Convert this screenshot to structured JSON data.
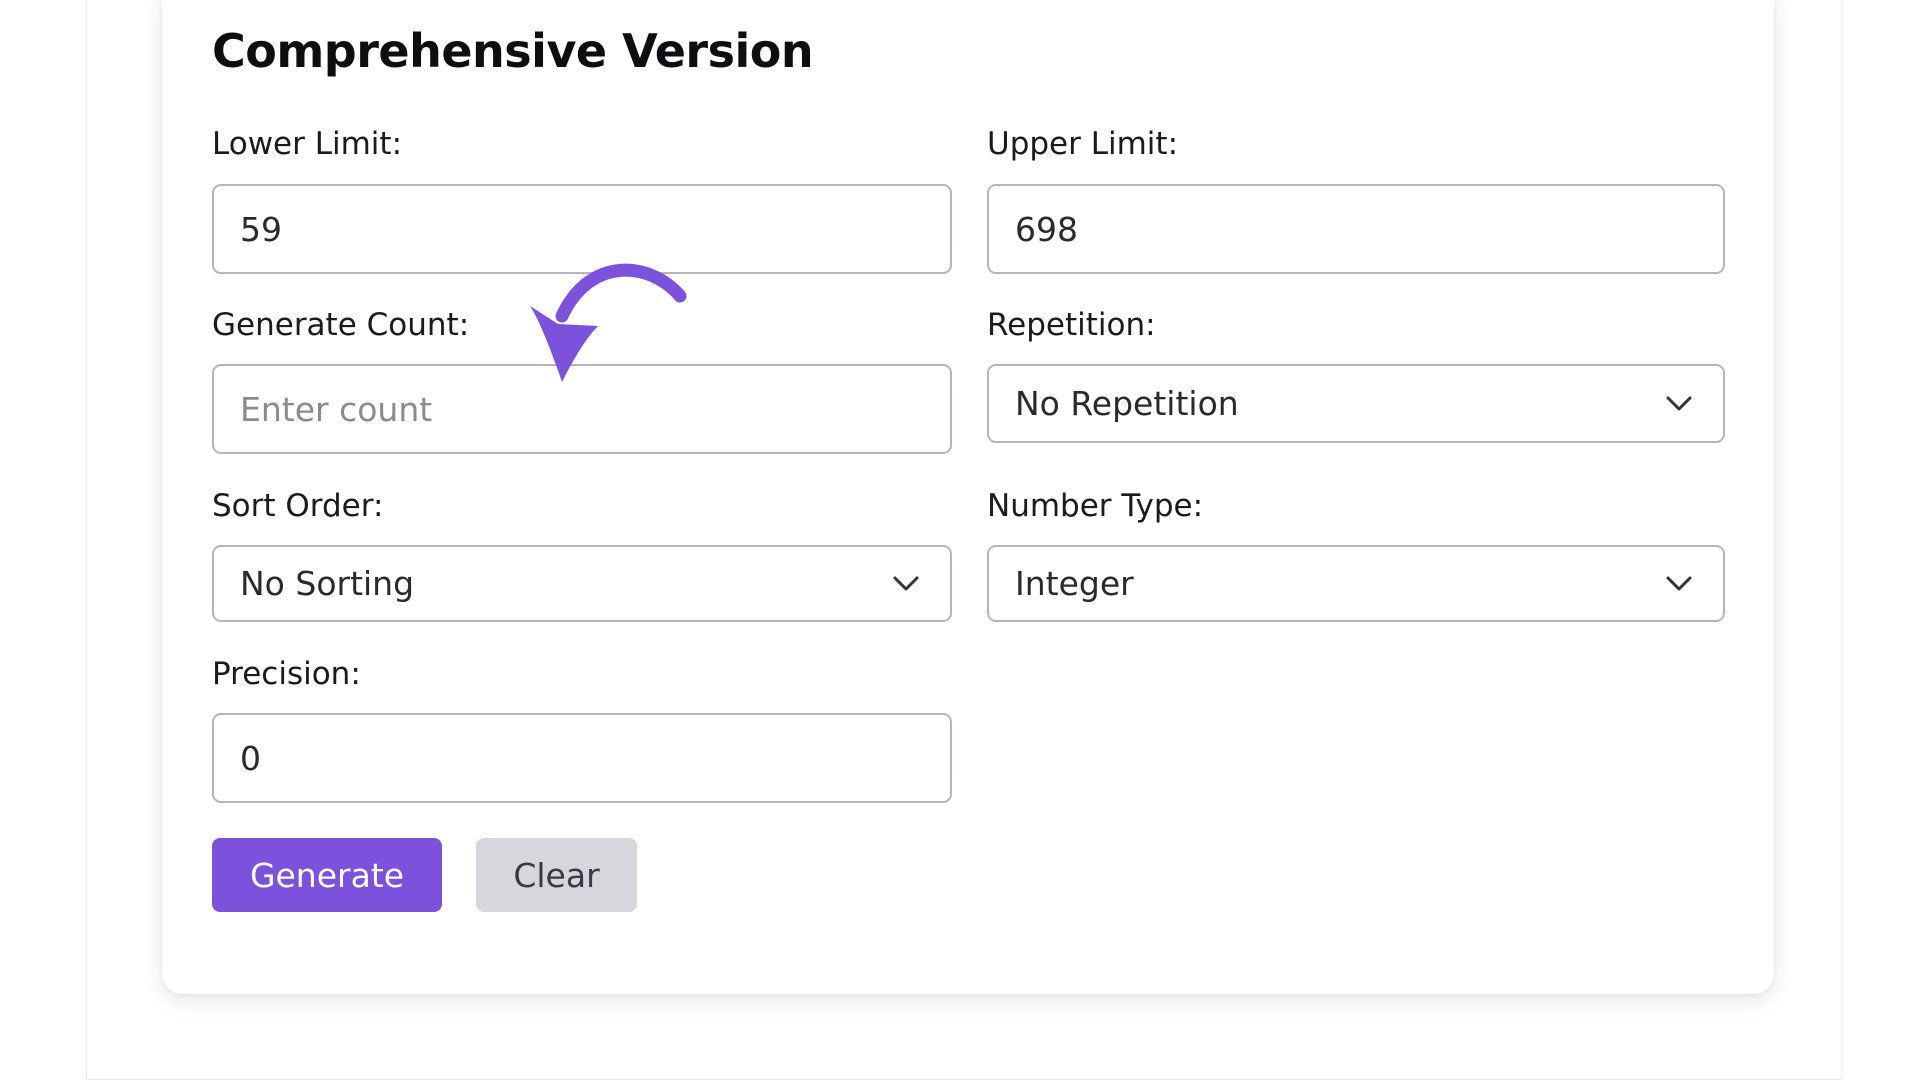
{
  "form": {
    "title": "Comprehensive Version",
    "lower_limit": {
      "label": "Lower Limit:",
      "value": "59"
    },
    "upper_limit": {
      "label": "Upper Limit:",
      "value": "698"
    },
    "generate_count": {
      "label": "Generate Count:",
      "value": "",
      "placeholder": "Enter count"
    },
    "repetition": {
      "label": "Repetition:",
      "selected": "No Repetition"
    },
    "sort_order": {
      "label": "Sort Order:",
      "selected": "No Sorting"
    },
    "number_type": {
      "label": "Number Type:",
      "selected": "Integer"
    },
    "precision": {
      "label": "Precision:",
      "value": "0"
    },
    "generate_button": "Generate",
    "clear_button": "Clear"
  },
  "annotation": {
    "icon": "curved-arrow-icon",
    "color": "#7c52dc"
  },
  "colors": {
    "accent": "#7c52dc",
    "secondary_button": "#d6d7dc",
    "field_border": "#b5b5bb"
  }
}
